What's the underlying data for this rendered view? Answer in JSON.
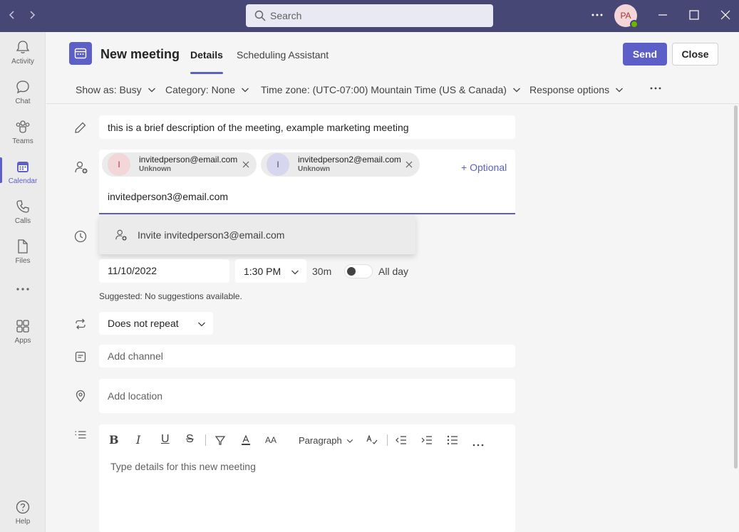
{
  "titlebar": {
    "search_placeholder": "Search",
    "avatar_initials": "PA"
  },
  "rail": {
    "items": [
      {
        "label": "Activity",
        "icon": "bell-icon"
      },
      {
        "label": "Chat",
        "icon": "chat-icon"
      },
      {
        "label": "Teams",
        "icon": "teams-icon"
      },
      {
        "label": "Calendar",
        "icon": "calendar-icon"
      },
      {
        "label": "Calls",
        "icon": "phone-icon"
      },
      {
        "label": "Files",
        "icon": "file-icon"
      },
      {
        "label": "Apps",
        "icon": "apps-icon"
      },
      {
        "label": "Help",
        "icon": "help-icon"
      }
    ],
    "active": "Calendar"
  },
  "header": {
    "title": "New meeting",
    "tabs": [
      {
        "label": "Details",
        "active": true
      },
      {
        "label": "Scheduling Assistant",
        "active": false
      }
    ],
    "send_label": "Send",
    "close_label": "Close"
  },
  "options": {
    "show_as": "Show as: Busy",
    "category": "Category: None",
    "time_zone": "Time zone: (UTC-07:00) Mountain Time (US & Canada)",
    "response": "Response options"
  },
  "form": {
    "title_value": "this is a brief description of the meeting, example marketing meeting",
    "attendees": [
      {
        "initial": "I",
        "email": "invitedperson@email.com",
        "status": "Unknown",
        "color": "#f3d6d8",
        "text_color": "#a4373a"
      },
      {
        "initial": "I",
        "email": "invitedperson2@email.com",
        "status": "Unknown",
        "color": "#d6d6ee",
        "text_color": "#464775"
      }
    ],
    "optional_label": "+ Optional",
    "attendee_input_value": "invitedperson3@email.com",
    "suggestion": "Invite invitedperson3@email.com",
    "date_value": "11/10/2022",
    "time_value": "1:30 PM",
    "duration": "30m",
    "all_day_label": "All day",
    "suggested_text": "Suggested: No suggestions available.",
    "repeat_value": "Does not repeat",
    "channel_placeholder": "Add channel",
    "location_placeholder": "Add location",
    "editor_style": "Paragraph",
    "editor_placeholder": "Type details for this new meeting"
  },
  "colors": {
    "titlebar": "#464775",
    "accent": "#5b5fc7"
  }
}
